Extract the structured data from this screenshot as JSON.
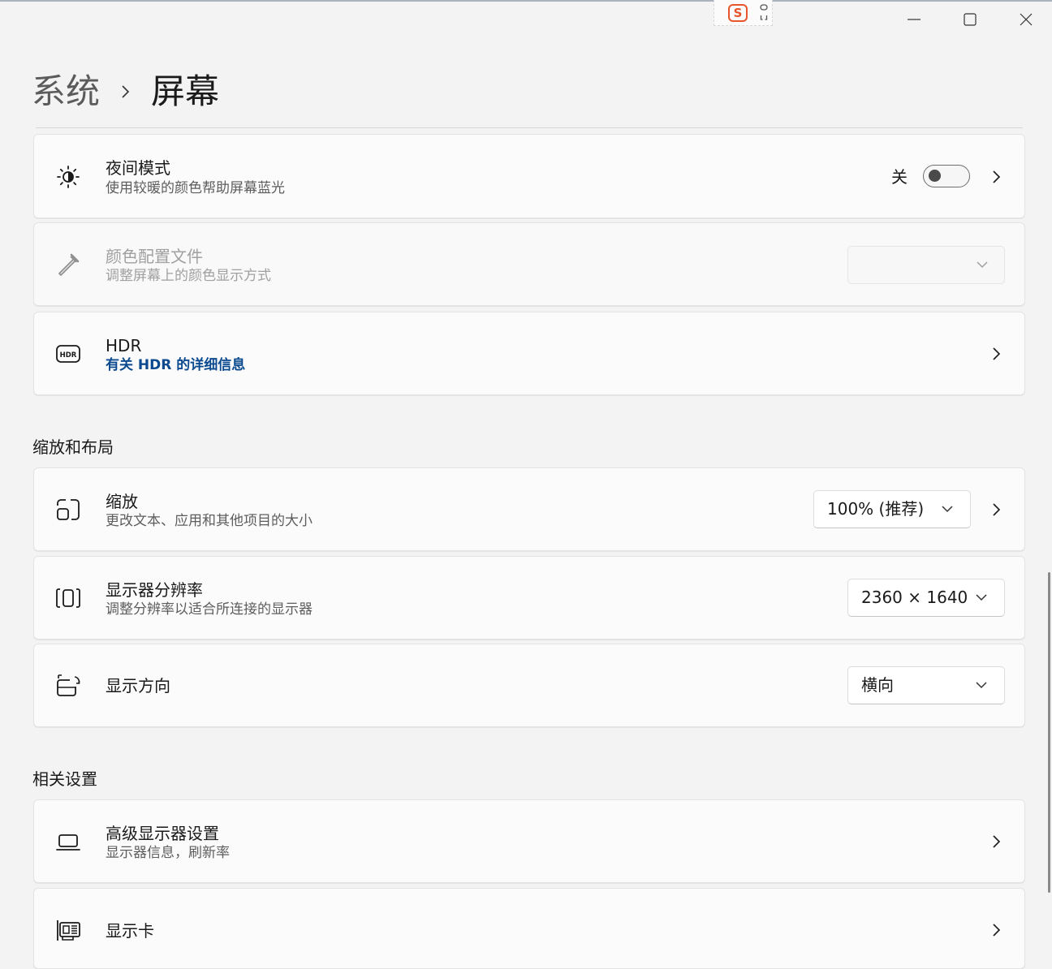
{
  "window": {
    "minimize_icon": "minimize-icon",
    "maximize_icon": "maximize-icon",
    "close_icon": "close-icon",
    "ime_logo": "S"
  },
  "breadcrumb": {
    "parent": "系统",
    "current": "屏幕"
  },
  "display": {
    "night_light": {
      "title": "夜间模式",
      "subtitle": "使用较暖的颜色帮助屏幕蓝光",
      "state_label": "关",
      "enabled": false
    },
    "color_profile": {
      "title": "颜色配置文件",
      "subtitle": "调整屏幕上的颜色显示方式",
      "value": ""
    },
    "hdr": {
      "title": "HDR",
      "link": "有关 HDR 的详细信息"
    }
  },
  "scale_layout": {
    "section_title": "缩放和布局",
    "scale": {
      "title": "缩放",
      "subtitle": "更改文本、应用和其他项目的大小",
      "value": "100% (推荐)"
    },
    "resolution": {
      "title": "显示器分辨率",
      "subtitle": "调整分辨率以适合所连接的显示器",
      "value": "2360 × 1640"
    },
    "orientation": {
      "title": "显示方向",
      "value": "横向"
    }
  },
  "related": {
    "section_title": "相关设置",
    "advanced": {
      "title": "高级显示器设置",
      "subtitle": "显示器信息，刷新率"
    },
    "graphics": {
      "title": "显示卡"
    }
  },
  "colors": {
    "link": "#0b4a8f",
    "accent_ime": "#e8542b"
  }
}
